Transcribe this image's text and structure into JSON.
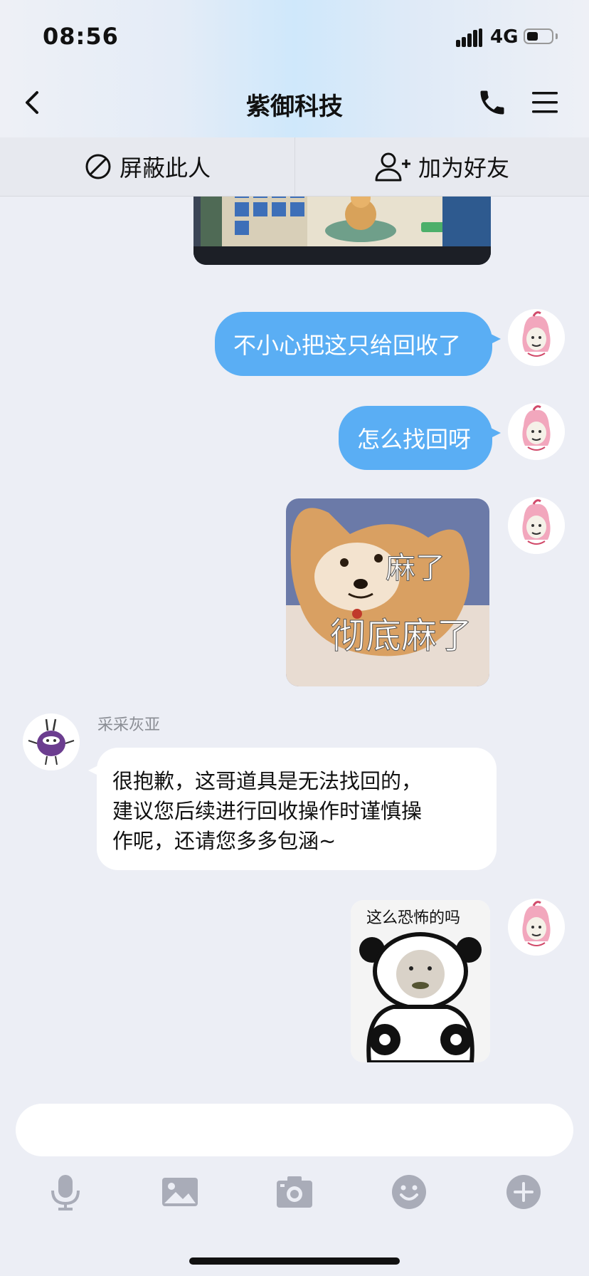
{
  "status_bar": {
    "time": "08:56",
    "network": "4G",
    "battery_level": 0.45
  },
  "nav": {
    "title": "紫御科技"
  },
  "actions": {
    "block_label": "屏蔽此人",
    "add_friend_label": "加为好友"
  },
  "messages": {
    "m1": {
      "text": "不小心把这只给回收了"
    },
    "m2": {
      "text": "怎么找回呀"
    },
    "m3": {
      "sticker_text_1": "麻了",
      "sticker_text_2": "彻底麻了"
    },
    "m4": {
      "sender": "采采灰亚",
      "line1": "很抱歉，这哥道具是无法找回的，",
      "line2": "建议您后续进行回收操作时谨慎操",
      "line3": "作呢，还请您多多包涵~"
    },
    "m5": {
      "sticker_text": "这么恐怖的吗"
    }
  },
  "input": {
    "placeholder": ""
  },
  "toolbar": [
    "mic-icon",
    "image-icon",
    "camera-icon",
    "emoji-icon",
    "plus-icon"
  ],
  "colors": {
    "accent": "#5aaef4",
    "background": "#eceef5",
    "toolbar_icon": "#a9acb8"
  }
}
